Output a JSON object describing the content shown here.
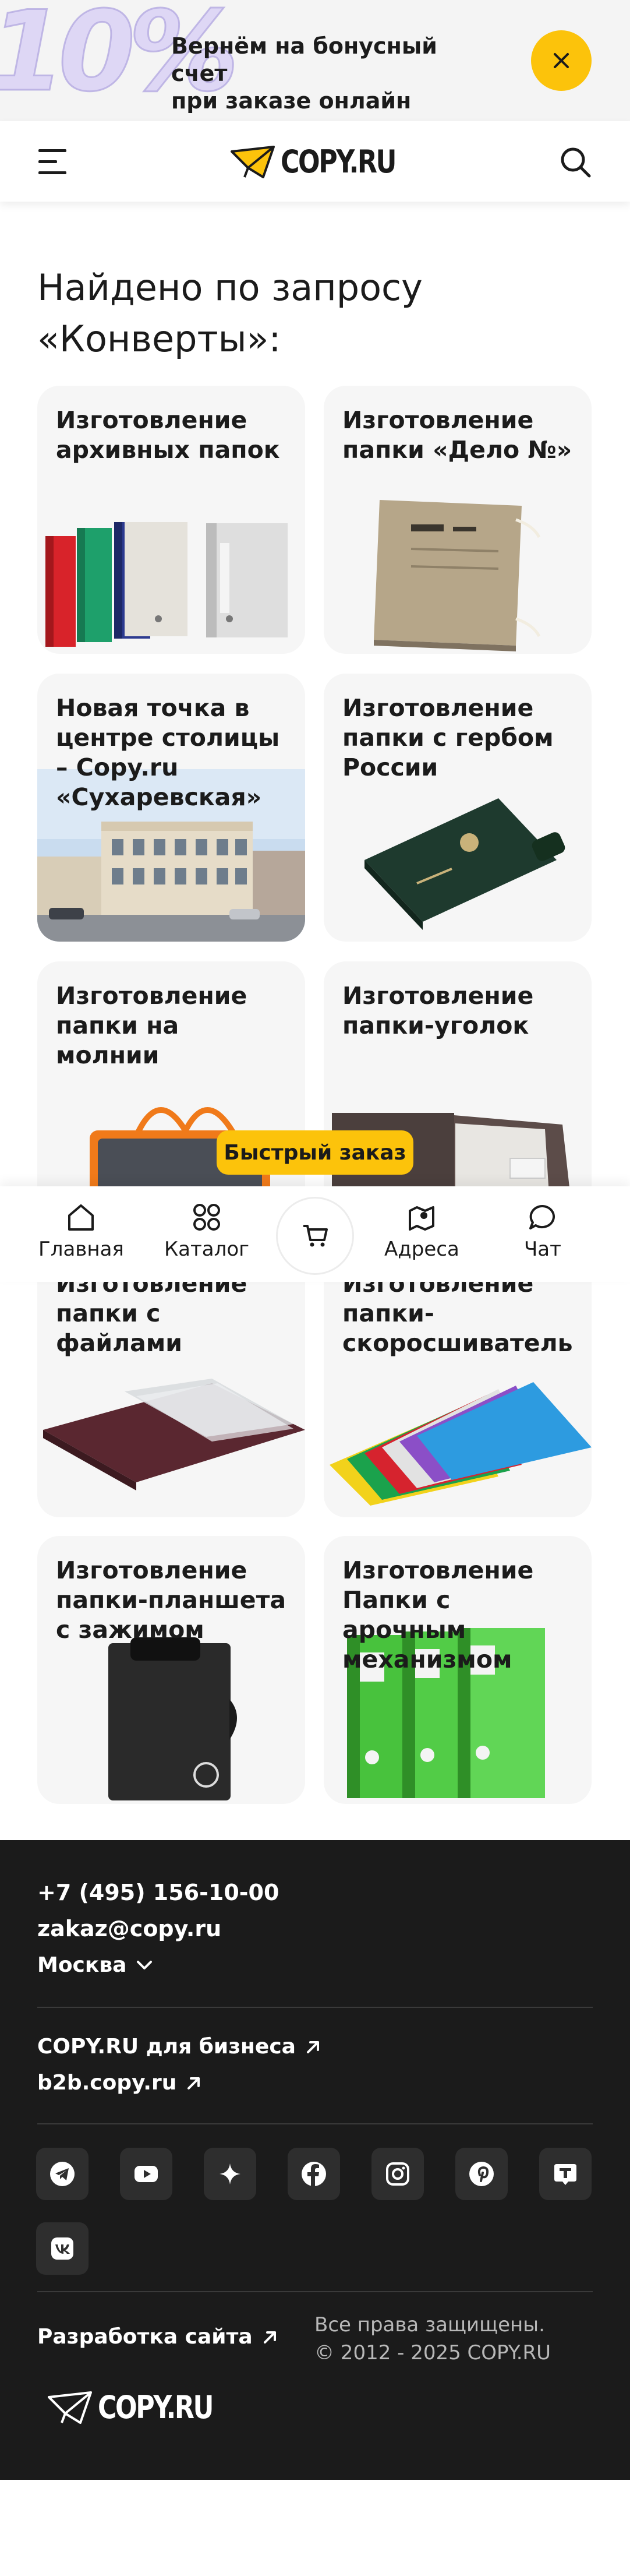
{
  "promo": {
    "percent": "10%",
    "line1": "Вернём на бонусный счет",
    "line2": "при заказе онлайн"
  },
  "header": {
    "logo": "COPY.RU"
  },
  "page_title_line1": "Найдено по запросу",
  "page_title_line2": "«Конверты»:",
  "cards": [
    {
      "title": "Изготовление архивных папок"
    },
    {
      "title": "Изготовление папки «Дело №»"
    },
    {
      "title": "Новая точка в центре столицы – Copy.ru «Сухаревская»"
    },
    {
      "title": "Изготовление папки с гербом России"
    },
    {
      "title": "Изготовление папки на молнии"
    },
    {
      "title": "Изготовление папки-уголок"
    },
    {
      "title": "Изготовление папки с файлами"
    },
    {
      "title": "Изготовление папки-скоросшиватель"
    },
    {
      "title": "Изготовление папки-планшета с зажимом"
    },
    {
      "title": "Изготовление Папки с арочным механизмом"
    }
  ],
  "quick_order": "Быстрый заказ",
  "nav": {
    "home": "Главная",
    "catalog": "Каталог",
    "addresses": "Адреса",
    "chat": "Чат"
  },
  "footer": {
    "phone": "+7 (495) 156-10-00",
    "email": "zakaz@copy.ru",
    "city": "Москва",
    "business": "COPY.RU для бизнеса",
    "b2b": "b2b.copy.ru",
    "dev": "Разработка сайта",
    "rights1": "Все права защищены.",
    "rights2": "© 2012 - 2025 COPY.RU",
    "logo": "COPY.RU"
  },
  "colors": {
    "accent": "#fcc30b",
    "footer_bg": "#1b1b1b",
    "card_bg": "#f6f6f6"
  }
}
